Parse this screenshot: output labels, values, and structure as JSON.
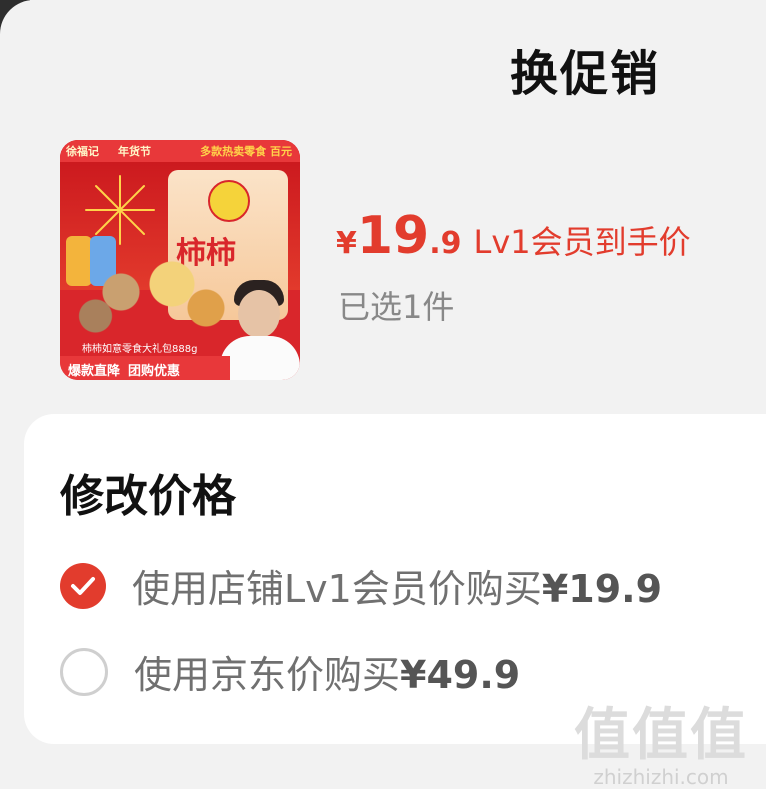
{
  "header": {
    "title": "换促销"
  },
  "product": {
    "thumbnail": {
      "brand_a": "徐福记",
      "brand_b": "年货节",
      "brand_c": "多款热卖零食  百元",
      "bag_text": "柿柿",
      "caption": "柿柿如意零食大礼包888g",
      "promo_a": "爆款直降",
      "promo_b": "团购优惠"
    },
    "price_symbol": "¥",
    "price_int": "19",
    "price_dec": ".9",
    "price_tag": "Lv1会员到手价",
    "selected_count": "已选1件"
  },
  "modify_price": {
    "title": "修改价格",
    "options": [
      {
        "label": "使用店铺Lv1会员价购买",
        "price": "¥19.9",
        "selected": true
      },
      {
        "label": "使用京东价购买",
        "price": "¥49.9",
        "selected": false
      }
    ]
  },
  "watermark": {
    "big": "值值值",
    "small": "zhizhizhi.com"
  },
  "colors": {
    "accent": "#e23c2d",
    "muted_text": "#707070",
    "background": "#f2f2f2"
  }
}
